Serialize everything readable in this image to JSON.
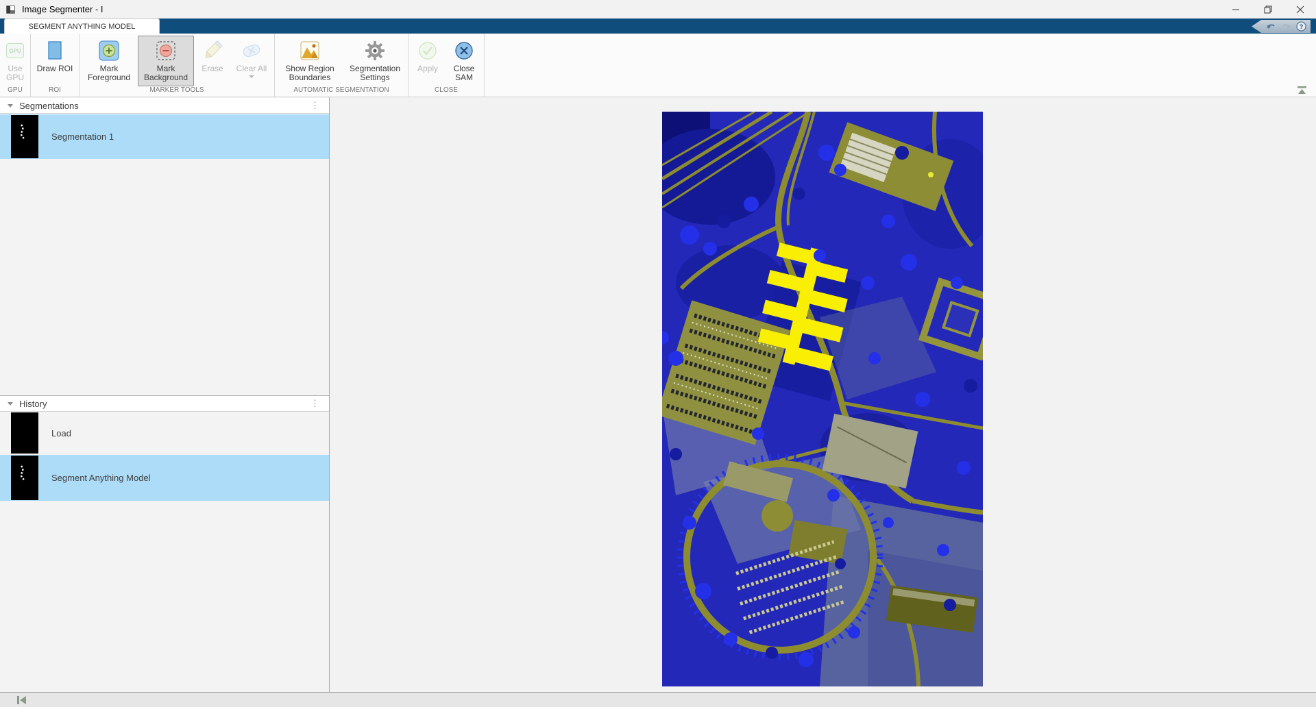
{
  "window": {
    "title": "Image Segmenter - I"
  },
  "tabs": [
    {
      "label": "SEGMENT ANYTHING MODEL",
      "active": true
    }
  ],
  "icon_texts": {
    "gpu": "GPU",
    "help": "?",
    "kebab": "⋮"
  },
  "ribbon": {
    "groups": [
      {
        "label": "GPU",
        "buttons": [
          {
            "label": "Use GPU",
            "icon": "gpu-icon",
            "enabled": false
          }
        ]
      },
      {
        "label": "ROI",
        "buttons": [
          {
            "label": "Draw ROI",
            "icon": "roi-rectangle-icon",
            "enabled": true
          }
        ]
      },
      {
        "label": "MARKER TOOLS",
        "buttons": [
          {
            "label": "Mark Foreground",
            "icon": "mark-foreground-icon",
            "enabled": true,
            "selected": false
          },
          {
            "label": "Mark Background",
            "icon": "mark-background-icon",
            "enabled": true,
            "selected": true
          },
          {
            "label": "Erase",
            "icon": "erase-pencil-icon",
            "enabled": false
          },
          {
            "label": "Clear All",
            "icon": "clear-all-icon",
            "enabled": false,
            "has_dropdown": true
          }
        ]
      },
      {
        "label": "AUTOMATIC SEGMENTATION",
        "buttons": [
          {
            "label": "Show Region Boundaries",
            "icon": "show-region-boundaries-icon",
            "enabled": true
          },
          {
            "label": "Segmentation Settings",
            "icon": "settings-gear-icon",
            "enabled": true
          }
        ]
      },
      {
        "label": "CLOSE",
        "buttons": [
          {
            "label": "Apply",
            "icon": "apply-check-icon",
            "enabled": false
          },
          {
            "label": "Close SAM",
            "icon": "close-sam-icon",
            "enabled": true
          }
        ]
      }
    ]
  },
  "panels": {
    "segmentations": {
      "title": "Segmentations",
      "items": [
        {
          "label": "Segmentation 1",
          "selected": true
        }
      ]
    },
    "history": {
      "title": "History",
      "items": [
        {
          "label": "Load",
          "selected": false
        },
        {
          "label": "Segment Anything Model",
          "selected": true
        }
      ]
    }
  },
  "colors": {
    "tab_band": "#0f4e7c",
    "selection": "#addcf8",
    "segmented_region": "#f8ef04"
  }
}
